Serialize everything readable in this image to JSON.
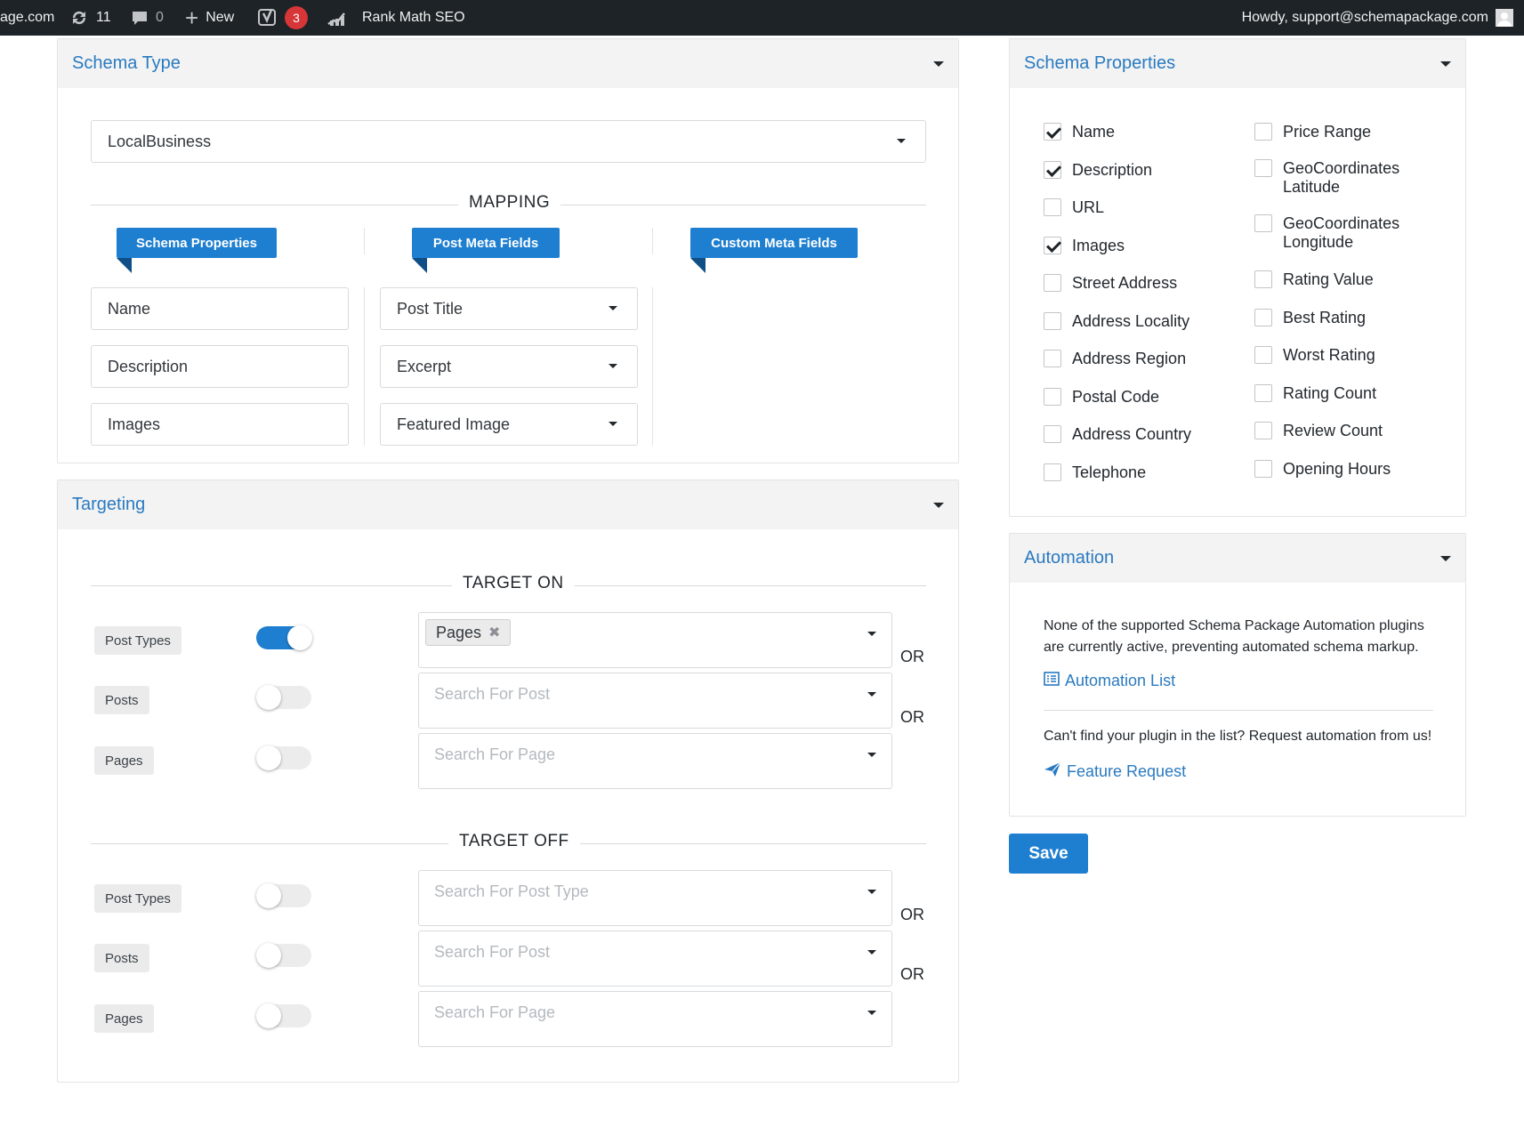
{
  "admin_bar": {
    "site": "age.com",
    "updates_count": "11",
    "comments_count": "0",
    "new_label": "New",
    "yoast_badge": "3",
    "rank_math_label": "Rank Math SEO",
    "howdy": "Howdy, support@schemapackage.com"
  },
  "schema_type": {
    "title": "Schema Type",
    "selected": "LocalBusiness",
    "mapping_label": "MAPPING",
    "columns": [
      "Schema Properties",
      "Post Meta Fields",
      "Custom Meta Fields"
    ],
    "rows": [
      {
        "property": "Name",
        "meta": "Post Title"
      },
      {
        "property": "Description",
        "meta": "Excerpt"
      },
      {
        "property": "Images",
        "meta": "Featured Image"
      }
    ]
  },
  "targeting": {
    "title": "Targeting",
    "target_on_label": "TARGET ON",
    "target_off_label": "TARGET OFF",
    "or_label": "OR",
    "target_on": [
      {
        "label": "Post Types",
        "on": true,
        "chip": "Pages",
        "placeholder": ""
      },
      {
        "label": "Posts",
        "on": false,
        "chip": "",
        "placeholder": "Search For Post"
      },
      {
        "label": "Pages",
        "on": false,
        "chip": "",
        "placeholder": "Search For Page"
      }
    ],
    "target_off": [
      {
        "label": "Post Types",
        "on": false,
        "placeholder": "Search For Post Type"
      },
      {
        "label": "Posts",
        "on": false,
        "placeholder": "Search For Post"
      },
      {
        "label": "Pages",
        "on": false,
        "placeholder": "Search For Page"
      }
    ]
  },
  "schema_properties": {
    "title": "Schema Properties",
    "left": [
      {
        "label": "Name",
        "checked": true
      },
      {
        "label": "Description",
        "checked": true
      },
      {
        "label": "URL",
        "checked": false
      },
      {
        "label": "Images",
        "checked": true
      },
      {
        "label": "Street Address",
        "checked": false
      },
      {
        "label": "Address Locality",
        "checked": false
      },
      {
        "label": "Address Region",
        "checked": false
      },
      {
        "label": "Postal Code",
        "checked": false
      },
      {
        "label": "Address Country",
        "checked": false
      },
      {
        "label": "Telephone",
        "checked": false
      }
    ],
    "right": [
      {
        "label": "Price Range",
        "checked": false
      },
      {
        "label": "GeoCoordinates Latitude",
        "checked": false
      },
      {
        "label": "GeoCoordinates Longitude",
        "checked": false
      },
      {
        "label": "Rating Value",
        "checked": false
      },
      {
        "label": "Best Rating",
        "checked": false
      },
      {
        "label": "Worst Rating",
        "checked": false
      },
      {
        "label": "Rating Count",
        "checked": false
      },
      {
        "label": "Review Count",
        "checked": false
      },
      {
        "label": "Opening Hours",
        "checked": false
      }
    ]
  },
  "automation": {
    "title": "Automation",
    "message": "None of the supported Schema Package Automation plugins are currently active, preventing automated schema markup.",
    "list_link": "Automation List",
    "request_text": "Can't find your plugin in the list? Request automation from us!",
    "feature_link": "Feature Request"
  },
  "save_label": "Save",
  "colors": {
    "accent": "#1e7fd0",
    "link": "#2a7ac0",
    "admin_bar": "#1d2327",
    "badge": "#d63638"
  }
}
